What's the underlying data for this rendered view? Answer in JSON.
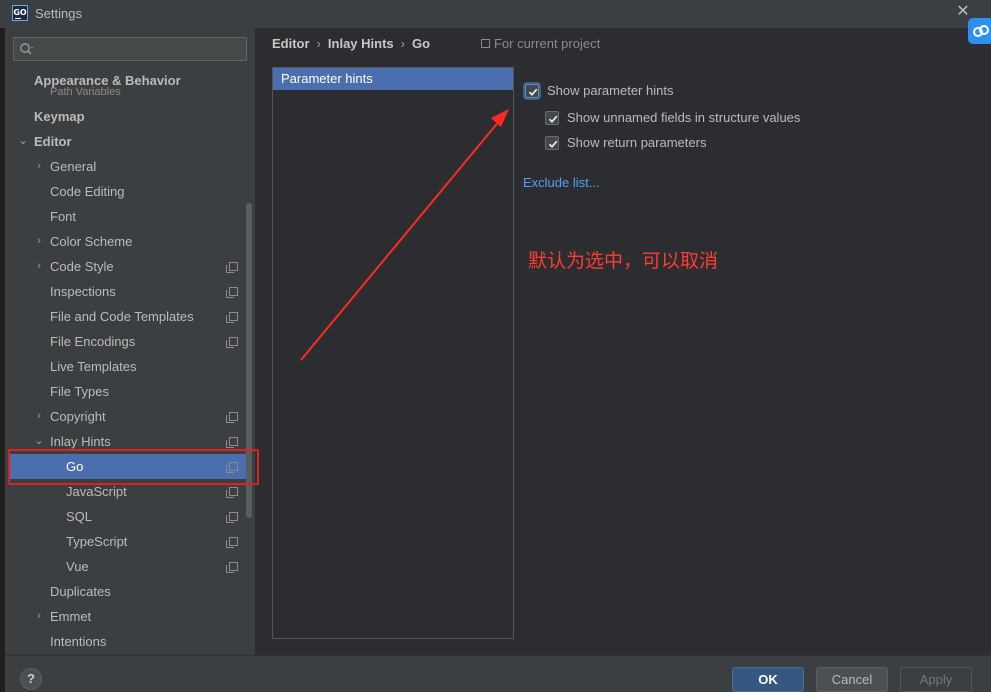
{
  "window": {
    "title": "Settings",
    "logo_text": "GO",
    "close_glyph": "✕"
  },
  "sidebar": {
    "search_placeholder": "",
    "ghost_item": "Path Variables",
    "items": [
      {
        "label": "Appearance & Behavior",
        "chevron": "",
        "has_copy": false,
        "selected": false
      },
      {
        "label": "Keymap",
        "chevron": "",
        "has_copy": false,
        "selected": false
      },
      {
        "label": "Editor",
        "chevron": "⌄",
        "has_copy": false,
        "selected": false
      },
      {
        "label": "General",
        "chevron": "›",
        "has_copy": false,
        "selected": false
      },
      {
        "label": "Code Editing",
        "chevron": "",
        "has_copy": false,
        "selected": false
      },
      {
        "label": "Font",
        "chevron": "",
        "has_copy": false,
        "selected": false
      },
      {
        "label": "Color Scheme",
        "chevron": "›",
        "has_copy": false,
        "selected": false
      },
      {
        "label": "Code Style",
        "chevron": "›",
        "has_copy": true,
        "selected": false
      },
      {
        "label": "Inspections",
        "chevron": "",
        "has_copy": true,
        "selected": false
      },
      {
        "label": "File and Code Templates",
        "chevron": "",
        "has_copy": true,
        "selected": false
      },
      {
        "label": "File Encodings",
        "chevron": "",
        "has_copy": true,
        "selected": false
      },
      {
        "label": "Live Templates",
        "chevron": "",
        "has_copy": false,
        "selected": false
      },
      {
        "label": "File Types",
        "chevron": "",
        "has_copy": false,
        "selected": false
      },
      {
        "label": "Copyright",
        "chevron": "›",
        "has_copy": true,
        "selected": false
      },
      {
        "label": "Inlay Hints",
        "chevron": "⌄",
        "has_copy": true,
        "selected": false
      },
      {
        "label": "Go",
        "chevron": "",
        "has_copy": true,
        "selected": true
      },
      {
        "label": "JavaScript",
        "chevron": "",
        "has_copy": true,
        "selected": false
      },
      {
        "label": "SQL",
        "chevron": "",
        "has_copy": true,
        "selected": false
      },
      {
        "label": "TypeScript",
        "chevron": "",
        "has_copy": true,
        "selected": false
      },
      {
        "label": "Vue",
        "chevron": "",
        "has_copy": true,
        "selected": false
      },
      {
        "label": "Duplicates",
        "chevron": "",
        "has_copy": false,
        "selected": false
      },
      {
        "label": "Emmet",
        "chevron": "›",
        "has_copy": false,
        "selected": false
      },
      {
        "label": "Intentions",
        "chevron": "",
        "has_copy": false,
        "selected": false
      }
    ]
  },
  "breadcrumb": {
    "items": [
      "Editor",
      "Inlay Hints",
      "Go"
    ],
    "separator": "›"
  },
  "scope_label": "For current project",
  "hint_list": {
    "items": [
      "Parameter hints"
    ]
  },
  "options": {
    "show_parameter_hints": {
      "label": "Show parameter hints",
      "checked": true
    },
    "show_unnamed_fields": {
      "label": "Show unnamed fields in structure values",
      "checked": true
    },
    "show_return_parameters": {
      "label": "Show return parameters",
      "checked": true
    },
    "exclude_list": "Exclude list..."
  },
  "annotation": {
    "text": "默认为选中，可以取消",
    "color": "#ff3b2f"
  },
  "buttons": {
    "help": "?",
    "ok": "OK",
    "cancel": "Cancel",
    "apply": "Apply"
  },
  "colors": {
    "selection": "#4b6eaf",
    "link": "#589df6",
    "highlight_box": "#e02020",
    "primary_button": "#365880"
  }
}
